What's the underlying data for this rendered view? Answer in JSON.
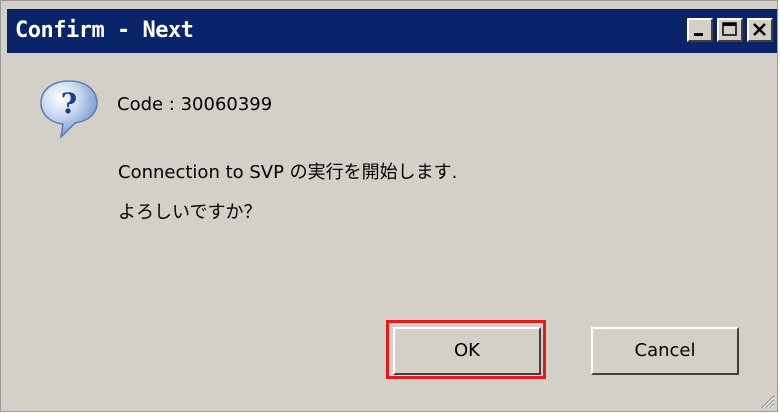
{
  "window": {
    "title": "Confirm - Next",
    "controls": {
      "minimize_icon": "minimize-icon",
      "maximize_icon": "maximize-icon",
      "close_icon": "close-icon"
    }
  },
  "dialog": {
    "icon": "question-icon",
    "code_line": "Code : 30060399",
    "message_line1": "Connection to SVP の実行を開始します.",
    "message_line2": "よろしいですか？"
  },
  "buttons": {
    "ok_label": "OK",
    "cancel_label": "Cancel"
  },
  "colors": {
    "titlebar": "#0a246a",
    "face": "#d4d0c8",
    "highlight_border": "#e8191d",
    "question_blue": "#3a6fc8"
  }
}
